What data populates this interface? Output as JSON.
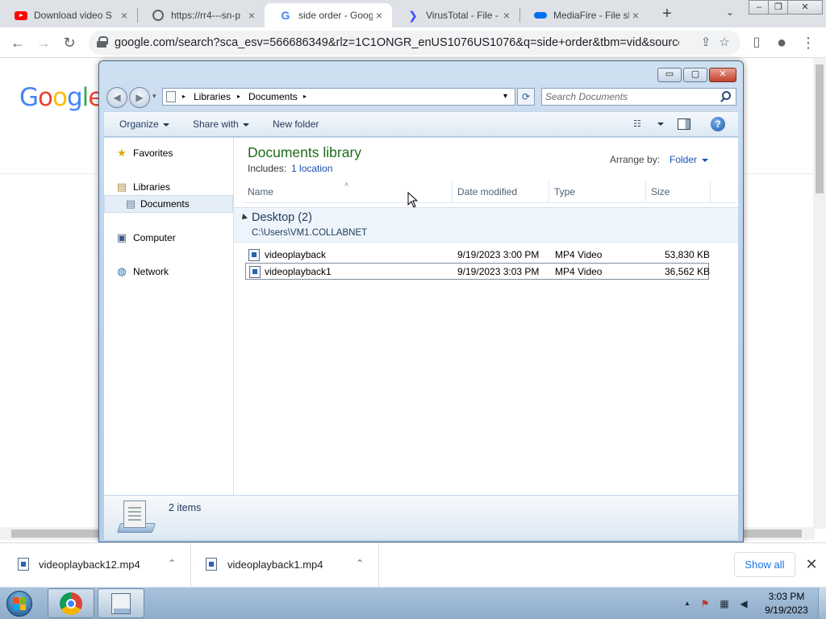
{
  "browser": {
    "tabs": [
      {
        "title": "Download video S",
        "favicon": "youtube-icon"
      },
      {
        "title": "https://rr4---sn-p",
        "favicon": "globe-icon"
      },
      {
        "title": "side order - Goog",
        "favicon": "google-g-icon",
        "active": true
      },
      {
        "title": "VirusTotal - File -",
        "favicon": "virustotal-icon"
      },
      {
        "title": "MediaFire - File sh",
        "favicon": "mediafire-icon"
      }
    ],
    "tab_close": "×",
    "new_tab": "+",
    "tab_search": "⌄",
    "window_controls": {
      "minimize": "‒",
      "restore": "❐",
      "close": "✕"
    },
    "nav": {
      "back": "←",
      "forward": "→",
      "reload": "↻"
    },
    "url": "google.com/search?sca_esv=566686349&rlz=1C1ONGR_enUS1076US1076&q=side+order&tbm=vid&source=ln...",
    "omnibox_icons": {
      "share": "⇪",
      "bookmark": "☆"
    },
    "toolbar_icons": {
      "side_panel": "▯",
      "profile": "●",
      "menu": "⋮"
    }
  },
  "google": {
    "logo_letters": [
      {
        "char": "G",
        "color": "#4285f4"
      },
      {
        "char": "o",
        "color": "#ea4335"
      },
      {
        "char": "o",
        "color": "#fbbc05"
      },
      {
        "char": "g",
        "color": "#4285f4"
      },
      {
        "char": "l",
        "color": "#34a853"
      },
      {
        "char": "e",
        "color": "#ea4335"
      }
    ]
  },
  "explorer": {
    "window_controls": {
      "minimize": "▭",
      "maximize": "▢",
      "close": "✕"
    },
    "nav": {
      "back": "◀",
      "forward": "▶",
      "recent": "▾"
    },
    "breadcrumb": [
      "Libraries",
      "Documents"
    ],
    "breadcrumb_sep": "▸",
    "breadcrumb_dropdown": "▾",
    "refresh": "⟳",
    "search_placeholder": "Search Documents",
    "commands": {
      "organize": "Organize",
      "share_with": "Share with",
      "new_folder": "New folder"
    },
    "view_icon": "☷",
    "help": "?",
    "navigation": {
      "favorites": "Favorites",
      "libraries": "Libraries",
      "documents": "Documents",
      "computer": "Computer",
      "network": "Network"
    },
    "nav_icons": {
      "favorites": "★",
      "libraries": "▤",
      "documents": "▤",
      "computer": "▣",
      "network": "◍"
    },
    "library_title": "Documents library",
    "includes_label": "Includes:",
    "includes_link": "1 location",
    "arrange_label": "Arrange by:",
    "arrange_value": "Folder",
    "columns": {
      "name": "Name",
      "date": "Date modified",
      "type": "Type",
      "size": "Size"
    },
    "sort_arrow": "˄",
    "group": {
      "title": "Desktop (2)",
      "path": "C:\\Users\\VM1.COLLABNET"
    },
    "files": [
      {
        "name": "videoplayback",
        "date": "9/19/2023 3:00 PM",
        "type": "MP4 Video",
        "size": "53,830 KB"
      },
      {
        "name": "videoplayback1",
        "date": "9/19/2023 3:03 PM",
        "type": "MP4 Video",
        "size": "36,562 KB"
      }
    ],
    "status": {
      "count": "2 items"
    }
  },
  "downloads": {
    "items": [
      {
        "name": "videoplayback12.mp4"
      },
      {
        "name": "videoplayback1.mp4"
      }
    ],
    "chevron": "⌃",
    "show_all": "Show all",
    "close": "✕"
  },
  "taskbar": {
    "clock_time": "3:03 PM",
    "clock_date": "9/19/2023",
    "tray_icons": {
      "arrow": "▲",
      "flag": "⚑",
      "network": "▦",
      "volume": "◀"
    }
  }
}
